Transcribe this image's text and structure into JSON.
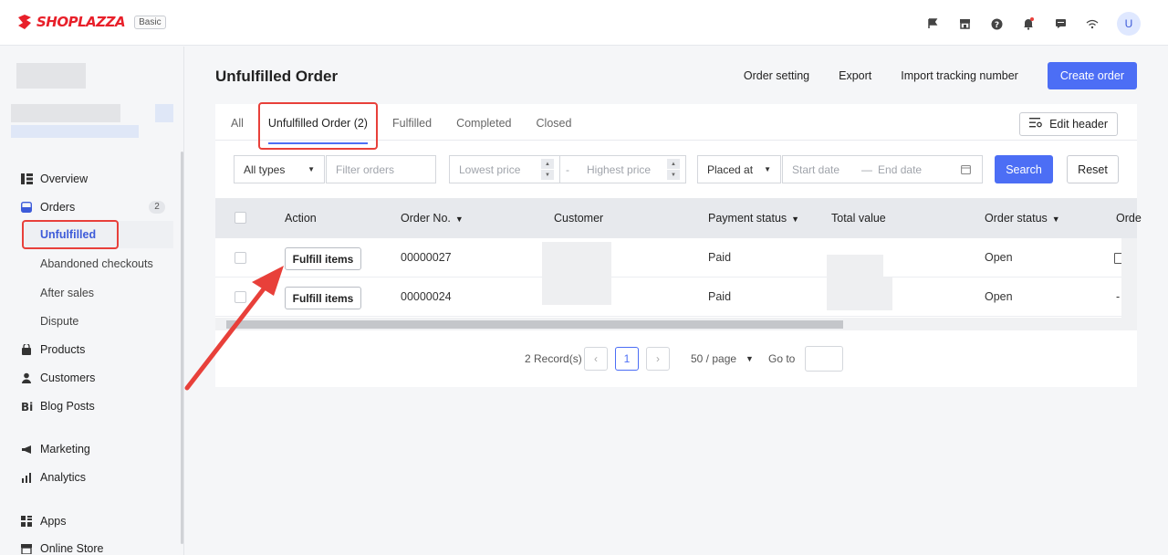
{
  "brand": {
    "name": "SHOPLAZZA",
    "plan": "Basic",
    "accent": "#e8202a"
  },
  "topbar": {
    "icons": [
      "flag-icon",
      "store-icon",
      "help-icon",
      "notification-bell-icon",
      "chat-icon",
      "wifi-icon"
    ],
    "avatar": "U"
  },
  "sidebar": {
    "overview": "Overview",
    "orders": "Orders",
    "orders_count": "2",
    "unfulfilled": "Unfulfilled",
    "abandoned": "Abandoned checkouts",
    "after_sales": "After sales",
    "dispute": "Dispute",
    "products": "Products",
    "customers": "Customers",
    "blog_posts": "Blog Posts",
    "marketing": "Marketing",
    "analytics": "Analytics",
    "apps": "Apps",
    "online_store": "Online Store"
  },
  "page": {
    "title": "Unfulfilled Order",
    "order_setting": "Order setting",
    "export": "Export",
    "import_tracking": "Import tracking number",
    "create_order": "Create order"
  },
  "tabs": {
    "all": "All",
    "unfulfilled": "Unfulfilled Order (2)",
    "fulfilled": "Fulfilled",
    "completed": "Completed",
    "closed": "Closed",
    "edit_header": "Edit header"
  },
  "filters": {
    "type_value": "All types",
    "filter_orders_placeholder": "Filter orders",
    "lowest_price_placeholder": "Lowest price",
    "dash": "-",
    "highest_price_placeholder": "Highest price",
    "date_field": "Placed at",
    "start_date_placeholder": "Start date",
    "date_sep": "—",
    "end_date_placeholder": "End date",
    "search": "Search",
    "reset": "Reset"
  },
  "table": {
    "headers": {
      "action": "Action",
      "order_no": "Order No.",
      "customer": "Customer",
      "payment_status": "Payment status",
      "total_value": "Total value",
      "order_status": "Order status",
      "order_more": "Orde"
    },
    "rows": [
      {
        "action": "Fulfill items",
        "order_no": "00000027",
        "payment": "Paid",
        "status": "Open",
        "extra": ""
      },
      {
        "action": "Fulfill items",
        "order_no": "00000024",
        "payment": "Paid",
        "status": "Open",
        "extra": "-"
      }
    ]
  },
  "pagination": {
    "records": "2 Record(s)",
    "current": "1",
    "page_size": "50 / page",
    "goto_label": "Go to"
  },
  "colors": {
    "primary": "#4c6ef5",
    "highlight": "#e8403a"
  }
}
